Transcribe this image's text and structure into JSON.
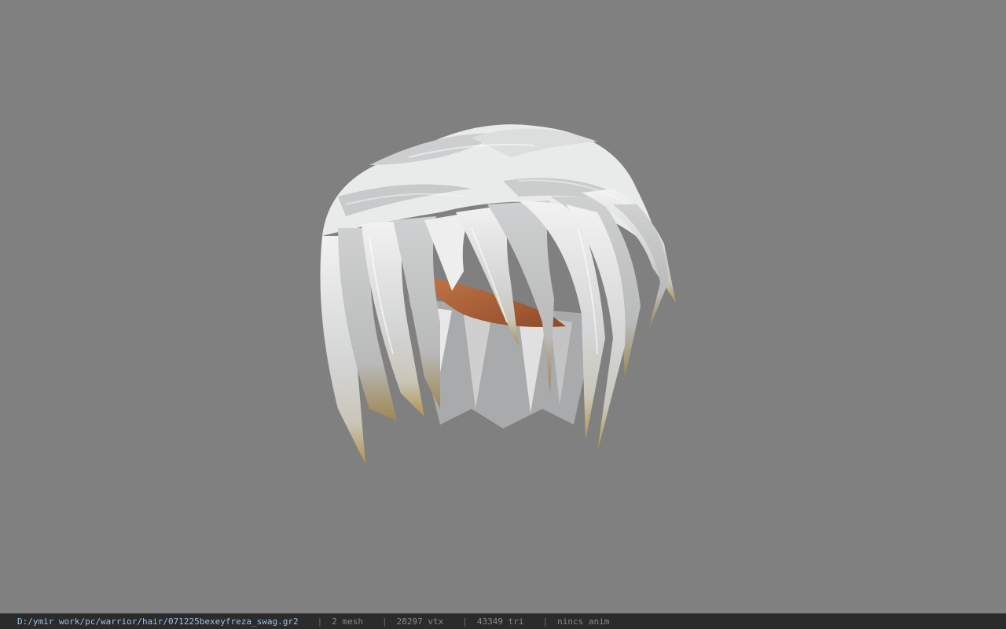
{
  "status": {
    "file_path": "D:/ymir work/pc/warrior/hair/071225bexeyfreza_swag.gr2",
    "separator": "|",
    "mesh": "2 mesh",
    "vertices": "28297 vtx",
    "triangles": "43349 tri",
    "anim": "nincs anim"
  },
  "colors": {
    "background": "#808080",
    "status_bar": "#2b2b2b",
    "path_text": "#9cc3e6",
    "info_text": "#8a8a8a",
    "hair": "#d9dadb",
    "hair_tips": "#b59a5a",
    "skin": "#b5673d"
  }
}
